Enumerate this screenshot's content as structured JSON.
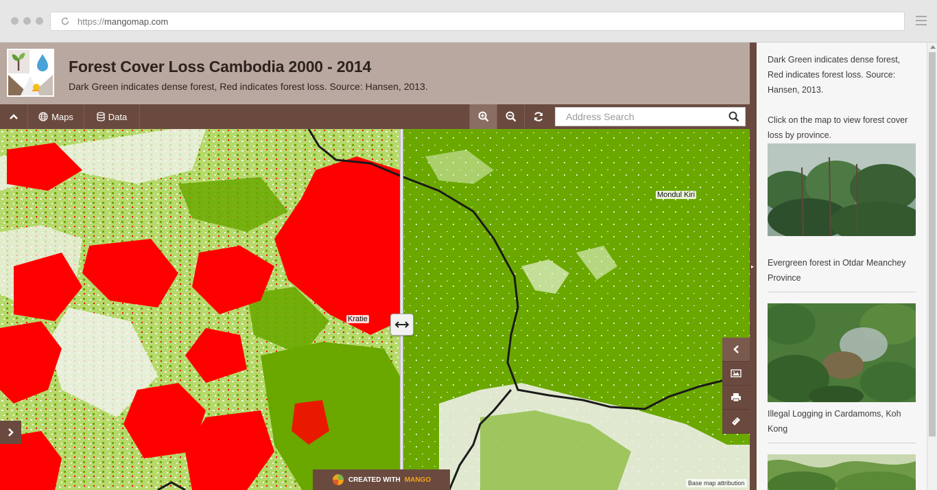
{
  "browser": {
    "url_scheme": "https://",
    "url_host": "mangomap.com"
  },
  "header": {
    "title": "Forest Cover Loss Cambodia 2000 - 2014",
    "subtitle": "Dark Green indicates dense forest, Red indicates forest loss. Source: Hansen, 2013."
  },
  "toolbar": {
    "maps_label": "Maps",
    "data_label": "Data",
    "search_placeholder": "Address Search"
  },
  "map": {
    "labels": {
      "kratie": "Kratie",
      "mondul_kiri": "Mondul Kiri"
    },
    "badge_prefix": "CREATED WITH",
    "badge_brand": "MANGO",
    "attribution": "Base map attribution",
    "colors": {
      "forest": "#6aa800",
      "forest_loss": "#ff0000",
      "light_forest": "#b5d96a",
      "non_forest": "#f4f4f4",
      "road": "#1a1a1a"
    }
  },
  "sidebar": {
    "intro": "Dark Green indicates dense forest, Red indicates forest loss. Source: Hansen, 2013.",
    "instruction": "Click on the map to view forest cover loss by province.",
    "captions": [
      "Evergreen forest in Otdar Meanchey Province",
      "Illegal Logging in Cardamoms, Koh Kong"
    ]
  },
  "theme": {
    "header_bg": "#b9a89f",
    "toolbar_bg": "#6a4a3f",
    "accent": "#f4a21a"
  }
}
